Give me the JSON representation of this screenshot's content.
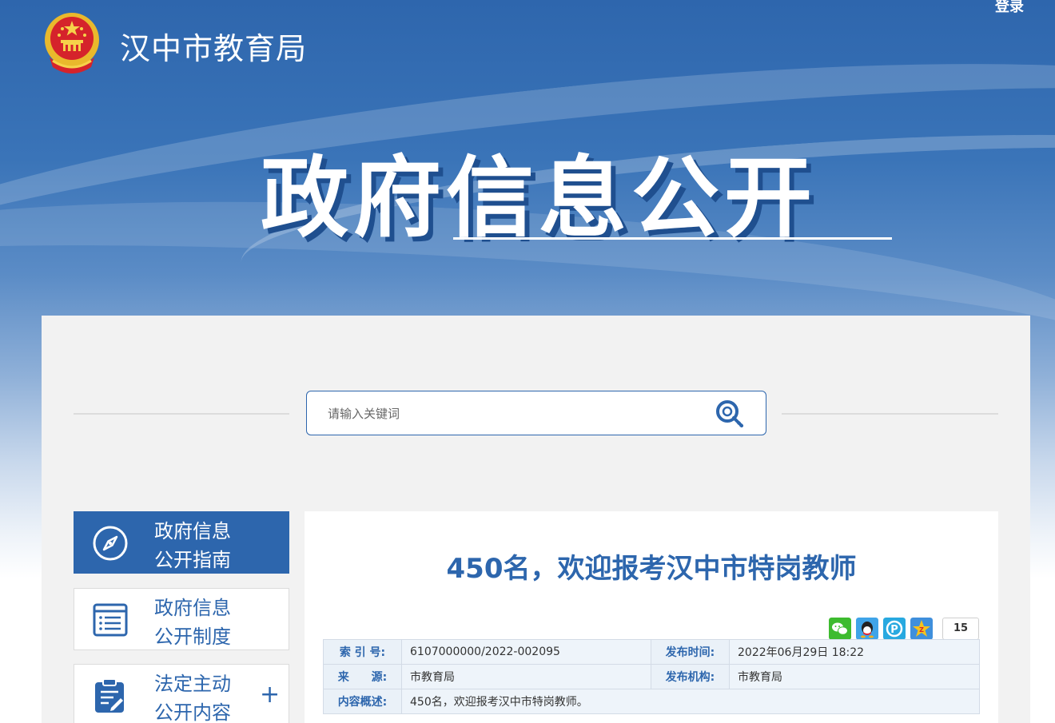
{
  "header": {
    "site_title": "汉中市教育局",
    "login": "登录",
    "hero_title": "政府信息公开"
  },
  "search": {
    "placeholder": "请输入关键词"
  },
  "sidebar": {
    "items": [
      {
        "line1": "政府信息",
        "line2": "公开指南",
        "icon": "compass-icon",
        "active": true
      },
      {
        "line1": "政府信息",
        "line2": "公开制度",
        "icon": "list-document-icon",
        "active": false
      },
      {
        "line1": "法定主动",
        "line2": "公开内容",
        "icon": "clipboard-edit-icon",
        "active": false,
        "expand": "+"
      }
    ]
  },
  "article": {
    "title": "450名，欢迎报考汉中市特岗教师",
    "share_count": "15",
    "share_icons": [
      "wechat-icon",
      "qq-icon",
      "qzone-icon",
      "star-icon"
    ]
  },
  "meta": {
    "index_label": "索 引 号:",
    "index_value": "6107000000/2022-002095",
    "time_label": "发布时间:",
    "time_value": "2022年06月29日 18:22",
    "source_label": "来　　源:",
    "source_value": "市教育局",
    "org_label": "发布机构:",
    "org_value": "市教育局",
    "summary_label": "内容概述:",
    "summary_value": "450名，欢迎报考汉中市特岗教师。"
  },
  "colors": {
    "brand_blue": "#2d66ad",
    "background": "#f2f2f2"
  }
}
